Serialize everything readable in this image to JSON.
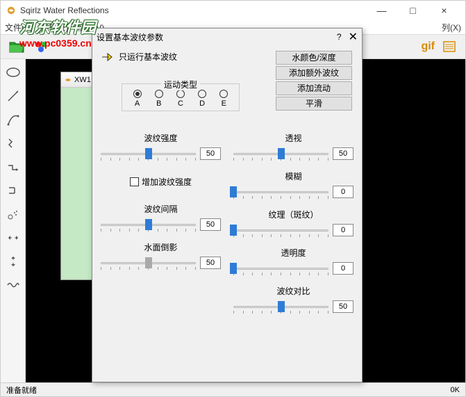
{
  "window": {
    "title": "Sqirlz Water Reflections",
    "min": "—",
    "max": "□",
    "close": "×"
  },
  "menubar": {
    "file": "文件(F)",
    "edit": "编辑(E)",
    "view": "视图(V)",
    "column": "列(X)"
  },
  "toolbar": {
    "gif": "gif"
  },
  "statusbar": {
    "ready": "准备就绪",
    "ok": "0K"
  },
  "inner_window": {
    "title": "XW1"
  },
  "dialog": {
    "title": "设置基本波纹参数",
    "help": "?",
    "close": "✕",
    "arrow_text": "只运行基本波纹",
    "buttons": {
      "b1": "水颜色/深度",
      "b2": "添加额外波纹",
      "b3": "添加流动",
      "b4": "平滑"
    },
    "motion": {
      "legend": "运动类型",
      "opts": [
        "A",
        "B",
        "C",
        "D",
        "E"
      ],
      "selected": 0
    },
    "left_sliders": {
      "s1": {
        "label": "波纹强度",
        "value": "50",
        "pos": 50,
        "thumb": "blue"
      },
      "checkbox_label": "增加波纹强度",
      "s2": {
        "label": "波纹间隔",
        "value": "50",
        "pos": 50,
        "thumb": "blue"
      },
      "s3": {
        "label": "水面倒影",
        "value": "50",
        "pos": 50,
        "thumb": "gray"
      }
    },
    "right_sliders": {
      "s1": {
        "label": "透视",
        "value": "50",
        "pos": 50,
        "thumb": "blue"
      },
      "s2": {
        "label": "模糊",
        "value": "0",
        "pos": 0,
        "thumb": "blue"
      },
      "s3": {
        "label": "纹理（斑纹）",
        "value": "0",
        "pos": 0,
        "thumb": "blue"
      },
      "s4": {
        "label": "透明度",
        "value": "0",
        "pos": 0,
        "thumb": "blue"
      },
      "s5": {
        "label": "波纹对比",
        "value": "50",
        "pos": 50,
        "thumb": "blue"
      }
    }
  },
  "watermark": {
    "text": "河东软件园",
    "url": "www.pc0359.cn"
  }
}
